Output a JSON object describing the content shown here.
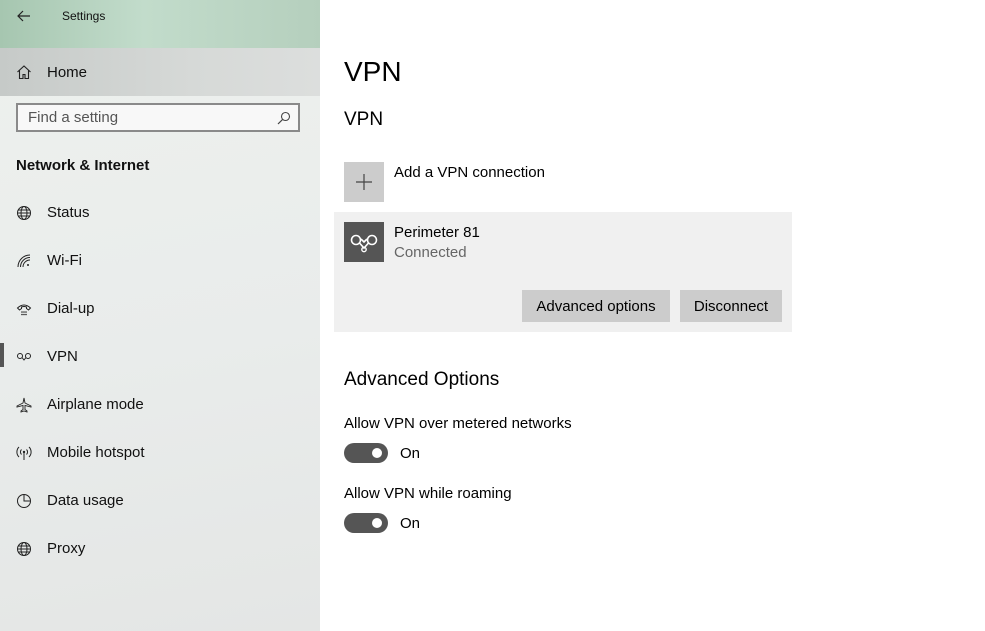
{
  "window": {
    "title": "Settings"
  },
  "sidebar": {
    "home_label": "Home",
    "search_placeholder": "Find a setting",
    "section_title": "Network & Internet",
    "items": [
      {
        "label": "Status",
        "icon": "globe-icon"
      },
      {
        "label": "Wi-Fi",
        "icon": "wifi-icon"
      },
      {
        "label": "Dial-up",
        "icon": "dialup-icon"
      },
      {
        "label": "VPN",
        "icon": "vpn-icon",
        "selected": true
      },
      {
        "label": "Airplane mode",
        "icon": "airplane-icon"
      },
      {
        "label": "Mobile hotspot",
        "icon": "hotspot-icon"
      },
      {
        "label": "Data usage",
        "icon": "data-usage-icon"
      },
      {
        "label": "Proxy",
        "icon": "globe-icon"
      }
    ]
  },
  "main": {
    "title": "VPN",
    "vpn_section_title": "VPN",
    "add_vpn_label": "Add a VPN connection",
    "connection": {
      "name": "Perimeter 81",
      "status": "Connected",
      "advanced_button": "Advanced options",
      "disconnect_button": "Disconnect"
    },
    "advanced": {
      "title": "Advanced Options",
      "options": [
        {
          "label": "Allow VPN over metered networks",
          "state": "On"
        },
        {
          "label": "Allow VPN while roaming",
          "state": "On"
        }
      ]
    }
  },
  "colors": {
    "titlebar_accent": "#b5cfbd",
    "toggle_on": "#555555",
    "button_bg": "#cccccc",
    "card_bg": "#f0f0f0"
  }
}
